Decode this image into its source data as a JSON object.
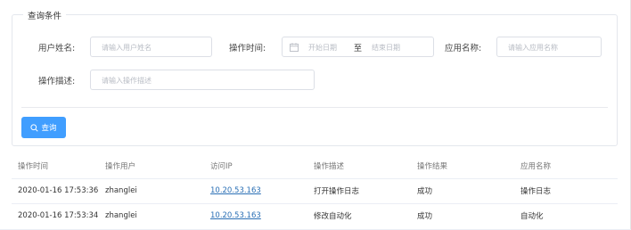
{
  "filter": {
    "legend": "查询条件",
    "user_name": {
      "label": "用户姓名:",
      "placeholder": "请输入用户姓名"
    },
    "op_time": {
      "label": "操作时间:",
      "start_placeholder": "开始日期",
      "separator": "至",
      "end_placeholder": "结束日期"
    },
    "app_name": {
      "label": "应用名称:",
      "placeholder": "请输入应用名称"
    },
    "op_desc": {
      "label": "操作描述:",
      "placeholder": "请输入操作描述"
    },
    "search_button": "查询"
  },
  "table": {
    "columns": [
      "操作时间",
      "操作用户",
      "访问IP",
      "操作描述",
      "操作结果",
      "应用名称"
    ],
    "rows": [
      [
        "2020-01-16 17:53:36",
        "zhanglei",
        "10.20.53.163",
        "打开操作日志",
        "成功",
        "操作日志"
      ],
      [
        "2020-01-16 17:53:34",
        "zhanglei",
        "10.20.53.163",
        "修改自动化",
        "成功",
        "自动化"
      ]
    ]
  },
  "colors": {
    "primary": "#409eff",
    "link": "#2a6fb5",
    "border": "#dcdfe6"
  },
  "icons": {
    "search_button": "search-icon",
    "date": "calendar-icon"
  }
}
